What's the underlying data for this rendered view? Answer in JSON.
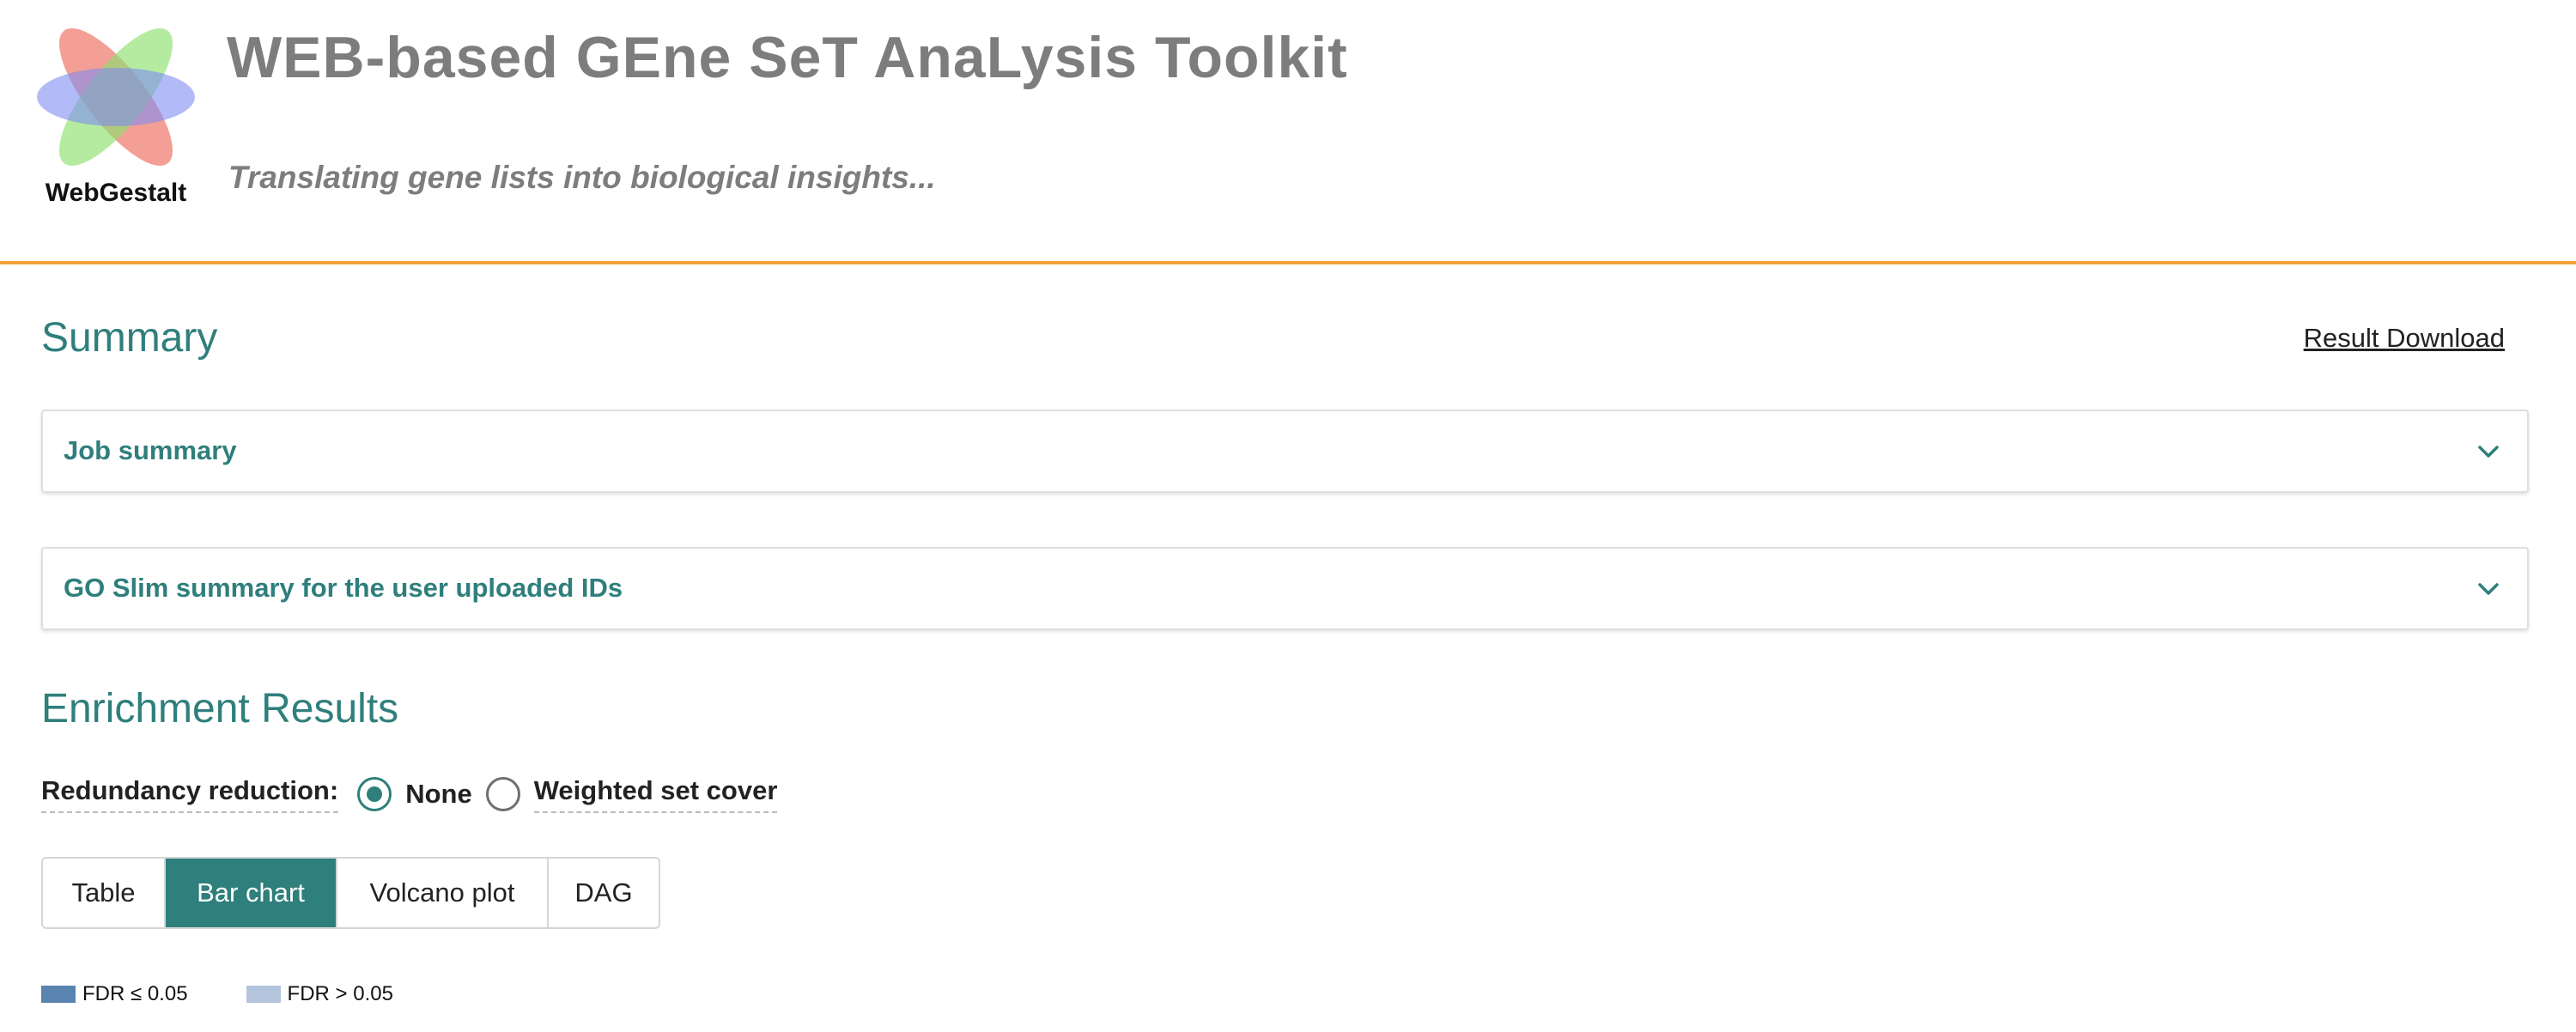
{
  "header": {
    "logo_text": "WebGestalt",
    "title": "WEB-based GEne SeT AnaLysis Toolkit",
    "subtitle": "Translating gene lists into biological insights..."
  },
  "summary": {
    "title": "Summary",
    "download_label": "Result Download",
    "accordions": [
      {
        "label": "Job summary",
        "icon": "chevron-down-icon"
      },
      {
        "label": "GO Slim summary for the user uploaded IDs",
        "icon": "chevron-down-icon"
      }
    ]
  },
  "enrichment": {
    "title": "Enrichment Results",
    "redundancy": {
      "label": "Redundancy reduction:",
      "options": [
        {
          "label": "None",
          "checked": true
        },
        {
          "label": "Weighted set cover",
          "checked": false
        }
      ]
    },
    "tabs": [
      {
        "label": "Table",
        "active": false
      },
      {
        "label": "Bar chart",
        "active": true
      },
      {
        "label": "Volcano plot",
        "active": false
      },
      {
        "label": "DAG",
        "active": false
      }
    ],
    "legend": [
      {
        "label": "FDR ≤ 0.05",
        "color": "#5a84b0"
      },
      {
        "label": "FDR > 0.05",
        "color": "#b3c4dc"
      }
    ]
  },
  "colors": {
    "accent": "#2f7f7c",
    "header_rule": "#f2a33a",
    "title_gray": "#7d7d7d"
  }
}
